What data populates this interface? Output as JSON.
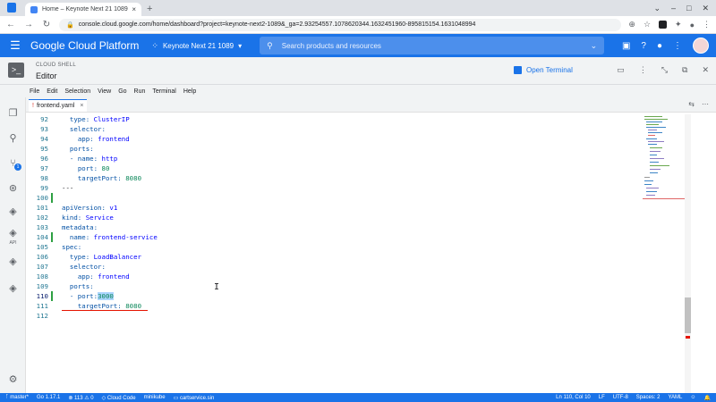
{
  "browser": {
    "tab_title": "Home – Keynote Next 21 1089",
    "tab_close": "×",
    "new_tab": "+",
    "url": "console.cloud.google.com/home/dashboard?project=keynote-next2-1089&_ga=2.93254557.1078620344.1632451960-895815154.1631048994",
    "window_controls": [
      "⌄",
      "–",
      "□",
      "✕"
    ]
  },
  "gcp": {
    "title": "Google Cloud Platform",
    "project": "Keynote Next 21 1089",
    "search_placeholder": "Search products and resources"
  },
  "shell": {
    "section_label": "CLOUD SHELL",
    "title": "Editor",
    "open_terminal": "Open Terminal"
  },
  "menu": [
    "File",
    "Edit",
    "Selection",
    "View",
    "Go",
    "Run",
    "Terminal",
    "Help"
  ],
  "editor": {
    "file_tab": "frontend.yaml",
    "tab_close": "×",
    "cursor_line": 110,
    "lines": [
      {
        "n": "92",
        "indent": "  ",
        "key": "type:",
        "val": " ClusterIP"
      },
      {
        "n": "93",
        "indent": "  ",
        "key": "selector:",
        "val": ""
      },
      {
        "n": "94",
        "indent": "    ",
        "key": "app:",
        "val": " frontend"
      },
      {
        "n": "95",
        "indent": "  ",
        "key": "ports:",
        "val": ""
      },
      {
        "n": "96",
        "indent": "  ",
        "key": "- name:",
        "val": " http"
      },
      {
        "n": "97",
        "indent": "    ",
        "key": "port:",
        "num": " 80"
      },
      {
        "n": "98",
        "indent": "    ",
        "key": "targetPort:",
        "num": " 8080"
      },
      {
        "n": "99",
        "indent": "",
        "plain": "---"
      },
      {
        "n": "100",
        "indent": "",
        "plain": ""
      },
      {
        "n": "101",
        "indent": "",
        "key": "apiVersion:",
        "val": " v1"
      },
      {
        "n": "102",
        "indent": "",
        "key": "kind:",
        "val": " Service"
      },
      {
        "n": "103",
        "indent": "",
        "key": "metadata:",
        "val": ""
      },
      {
        "n": "104",
        "indent": "  ",
        "key": "name:",
        "val": " frontend-service"
      },
      {
        "n": "105",
        "indent": "",
        "key": "spec:",
        "val": ""
      },
      {
        "n": "106",
        "indent": "  ",
        "key": "type:",
        "val": " LoadBalancer"
      },
      {
        "n": "107",
        "indent": "  ",
        "key": "selector:",
        "val": ""
      },
      {
        "n": "108",
        "indent": "    ",
        "key": "app:",
        "val": " frontend"
      },
      {
        "n": "109",
        "indent": "  ",
        "key": "ports:",
        "val": ""
      },
      {
        "n": "110",
        "indent": "  ",
        "key": "- port:",
        "num": "3000"
      },
      {
        "n": "111",
        "indent": "    ",
        "key": "targetPort:",
        "num": " 8080"
      },
      {
        "n": "112",
        "indent": "",
        "plain": ""
      }
    ]
  },
  "status": {
    "branch": "master*",
    "go": "Go 1.17.1",
    "problems": "⊗ 113 ⚠ 0",
    "cloud_code": "Cloud Code",
    "cluster": "minikube",
    "service": "cartservice.sin",
    "position": "Ln 110, Col 10",
    "eol": "LF",
    "encoding": "UTF-8",
    "spaces": "Spaces: 2",
    "language": "YAML"
  },
  "colors": {
    "gcp_blue": "#1a73e8",
    "yaml_key": "#0451a5",
    "yaml_value": "#0000ff",
    "yaml_number": "#098658"
  }
}
